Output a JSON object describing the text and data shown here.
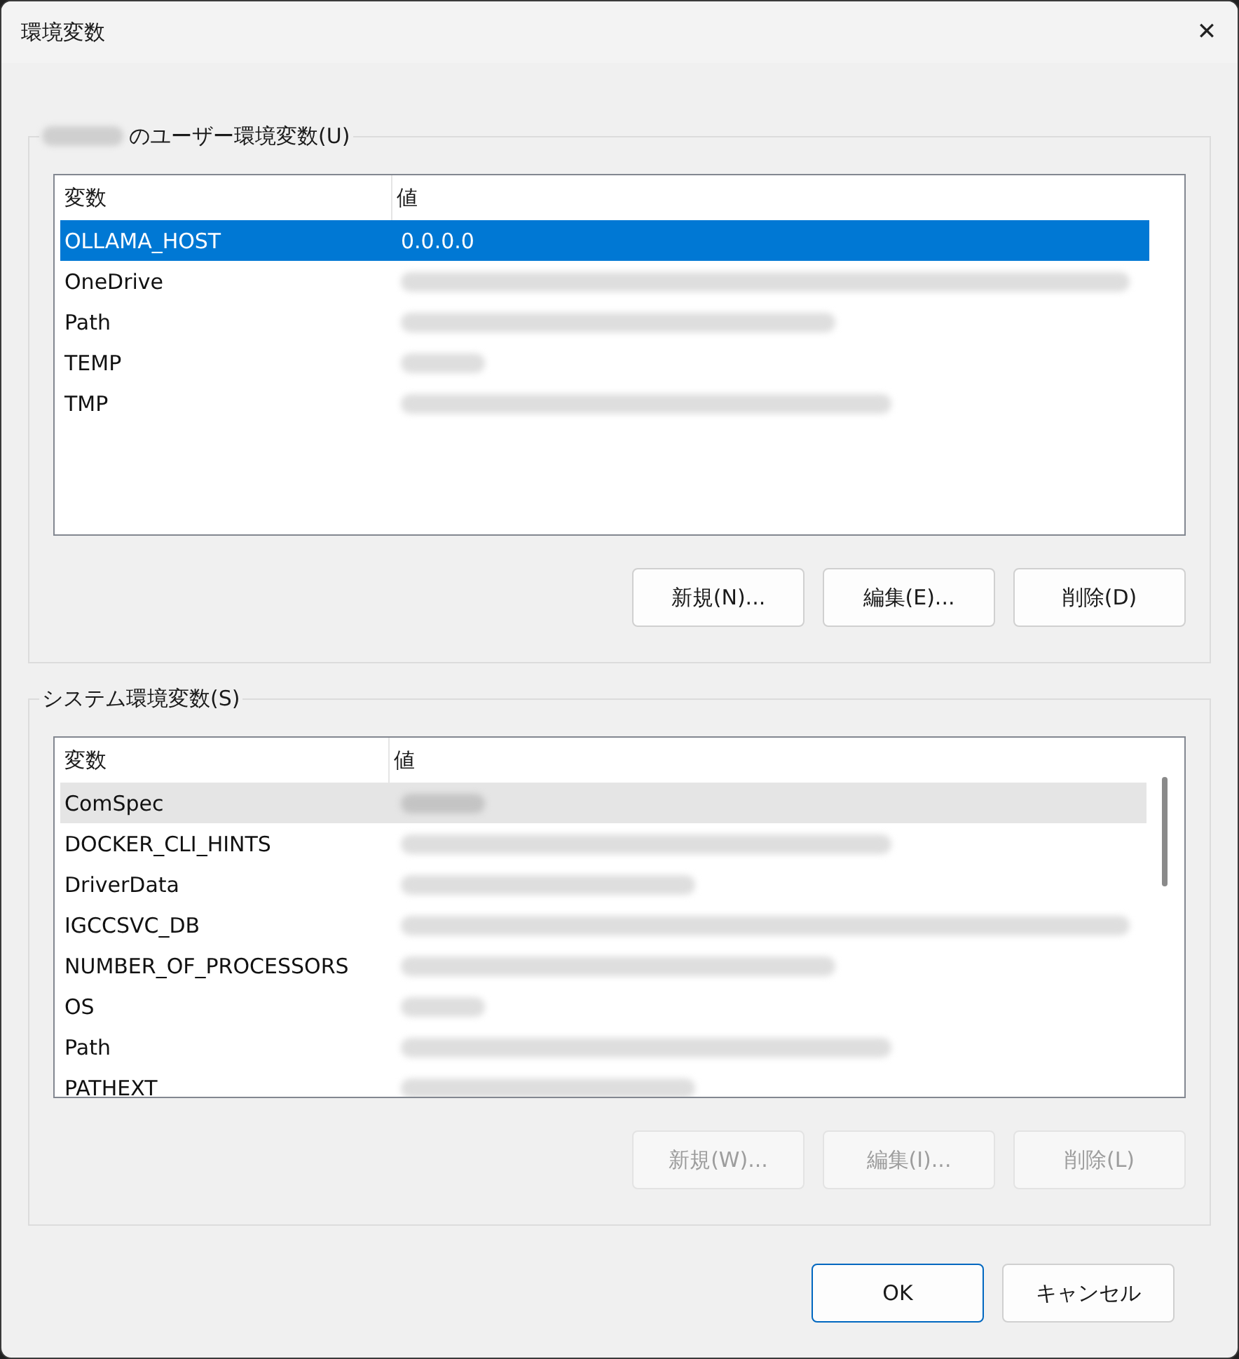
{
  "window": {
    "title": "環境変数",
    "close": "✕"
  },
  "groups": [
    {
      "title": "のユーザー環境変数(U)",
      "title_prefix_redacted": true,
      "list": {
        "focused": true,
        "scrollbar": false,
        "columns": [
          "変数",
          "値"
        ],
        "rows": [
          {
            "name": "OLLAMA_HOST",
            "value": "0.0.0.0",
            "selected": true
          },
          {
            "name": "OneDrive",
            "selected": false
          },
          {
            "name": "Path",
            "selected": false
          },
          {
            "name": "TEMP",
            "selected": false
          },
          {
            "name": "TMP",
            "selected": false
          }
        ]
      },
      "buttons": [
        {
          "label": "新規(N)...",
          "disabled": false
        },
        {
          "label": "編集(E)...",
          "disabled": false
        },
        {
          "label": "削除(D)",
          "disabled": false
        }
      ]
    },
    {
      "title": "システム環境変数(S)",
      "title_prefix_redacted": false,
      "list": {
        "focused": false,
        "scrollbar": true,
        "columns": [
          "変数",
          "値"
        ],
        "rows": [
          {
            "name": "ComSpec",
            "selected": true
          },
          {
            "name": "DOCKER_CLI_HINTS",
            "selected": false
          },
          {
            "name": "DriverData",
            "selected": false
          },
          {
            "name": "IGCCSVC_DB",
            "selected": false
          },
          {
            "name": "NUMBER_OF_PROCESSORS",
            "selected": false
          },
          {
            "name": "OS",
            "selected": false
          },
          {
            "name": "Path",
            "selected": false
          },
          {
            "name": "PATHEXT",
            "selected": false
          }
        ]
      },
      "buttons": [
        {
          "label": "新規(W)...",
          "disabled": true
        },
        {
          "label": "編集(I)...",
          "disabled": true
        },
        {
          "label": "削除(L)",
          "disabled": true
        }
      ]
    }
  ],
  "footer_buttons": [
    {
      "label": "OK",
      "default": true
    },
    {
      "label": "キャンセル",
      "default": false
    }
  ]
}
